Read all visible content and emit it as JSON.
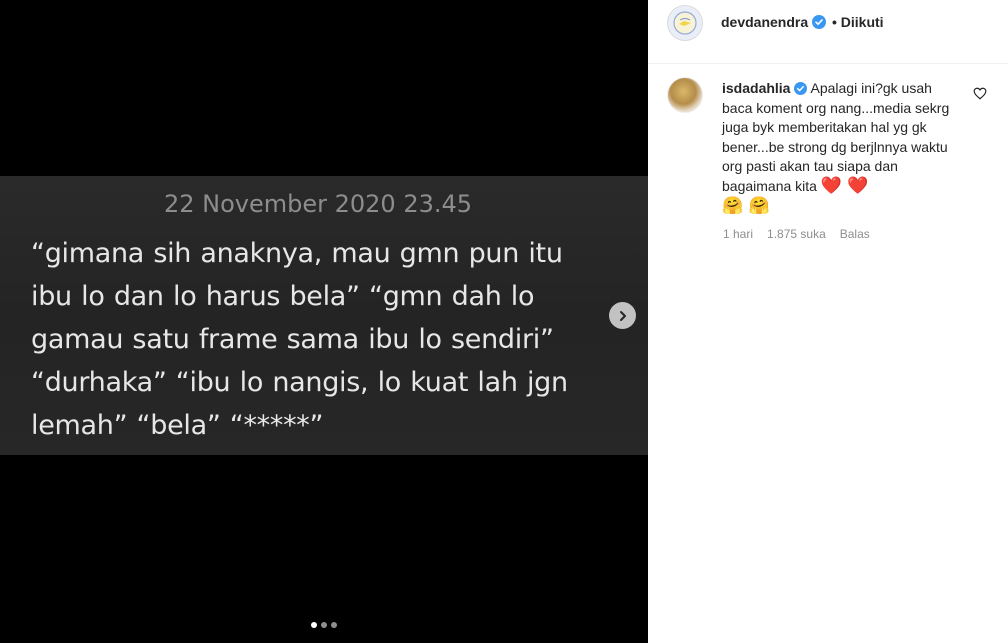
{
  "post": {
    "image_text": {
      "date": "22 November 2020 23.45",
      "lines": [
        "“gimana sih anaknya, mau gmn pun itu",
        "ibu lo dan lo harus bela” “gmn dah lo",
        "gamau satu frame sama ibu lo sendiri”",
        "“durhaka” “ibu lo nangis, lo kuat lah jgn",
        "lemah” “bela” “*****”"
      ]
    },
    "carousel": {
      "total": 3,
      "active_index": 0
    }
  },
  "header": {
    "owner_username": "devdanendra",
    "separator": "•",
    "follow_status": "Diikuti"
  },
  "comment": {
    "username": "isdadahlia",
    "text": "Apalagi ini?gk usah baca koment org nang...media sekrg juga byk memberitakan hal yg gk bener...be strong dg berjlnnya waktu org pasti akan tau siapa dan bagaimana kita",
    "emojis_line1": "❤️ ❤️",
    "emojis_line2": "🤗 🤗",
    "time": "1 hari",
    "likes": "1.875 suka",
    "reply_label": "Balas"
  },
  "colors": {
    "verified_blue": "#3897f0",
    "text_primary": "#262626",
    "text_secondary": "#8e8e8e"
  },
  "icons": {
    "next": "chevron-right-icon",
    "verified": "verified-badge-icon",
    "like": "heart-outline-icon"
  }
}
